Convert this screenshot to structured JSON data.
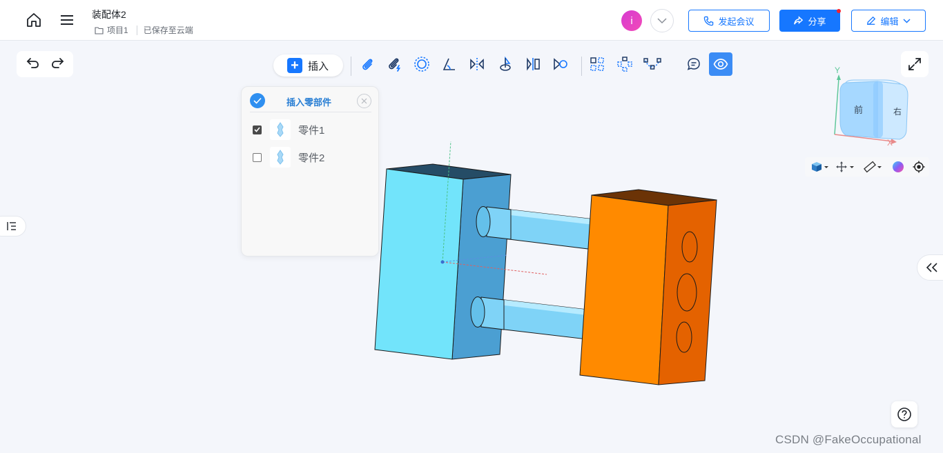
{
  "header": {
    "title": "装配体2",
    "project": "项目1",
    "save_status": "已保存至云端",
    "avatar_letter": "i",
    "meeting_label": "发起会议",
    "share_label": "分享",
    "edit_label": "编辑"
  },
  "toolbar": {
    "insert_label": "插入"
  },
  "panel": {
    "title": "插入零部件",
    "parts": [
      {
        "label": "零件1",
        "checked": true
      },
      {
        "label": "零件2",
        "checked": false
      }
    ]
  },
  "viewcube": {
    "front": "前",
    "right": "右",
    "axis_x": "X",
    "axis_y": "Y"
  },
  "watermark": "CSDN @FakeOccupational",
  "colors": {
    "accent": "#1677ff",
    "part1_face": "#6fe1fb",
    "part1_side": "#4fa0d0",
    "part2_face": "#ff8a00",
    "part2_side": "#e06000"
  }
}
